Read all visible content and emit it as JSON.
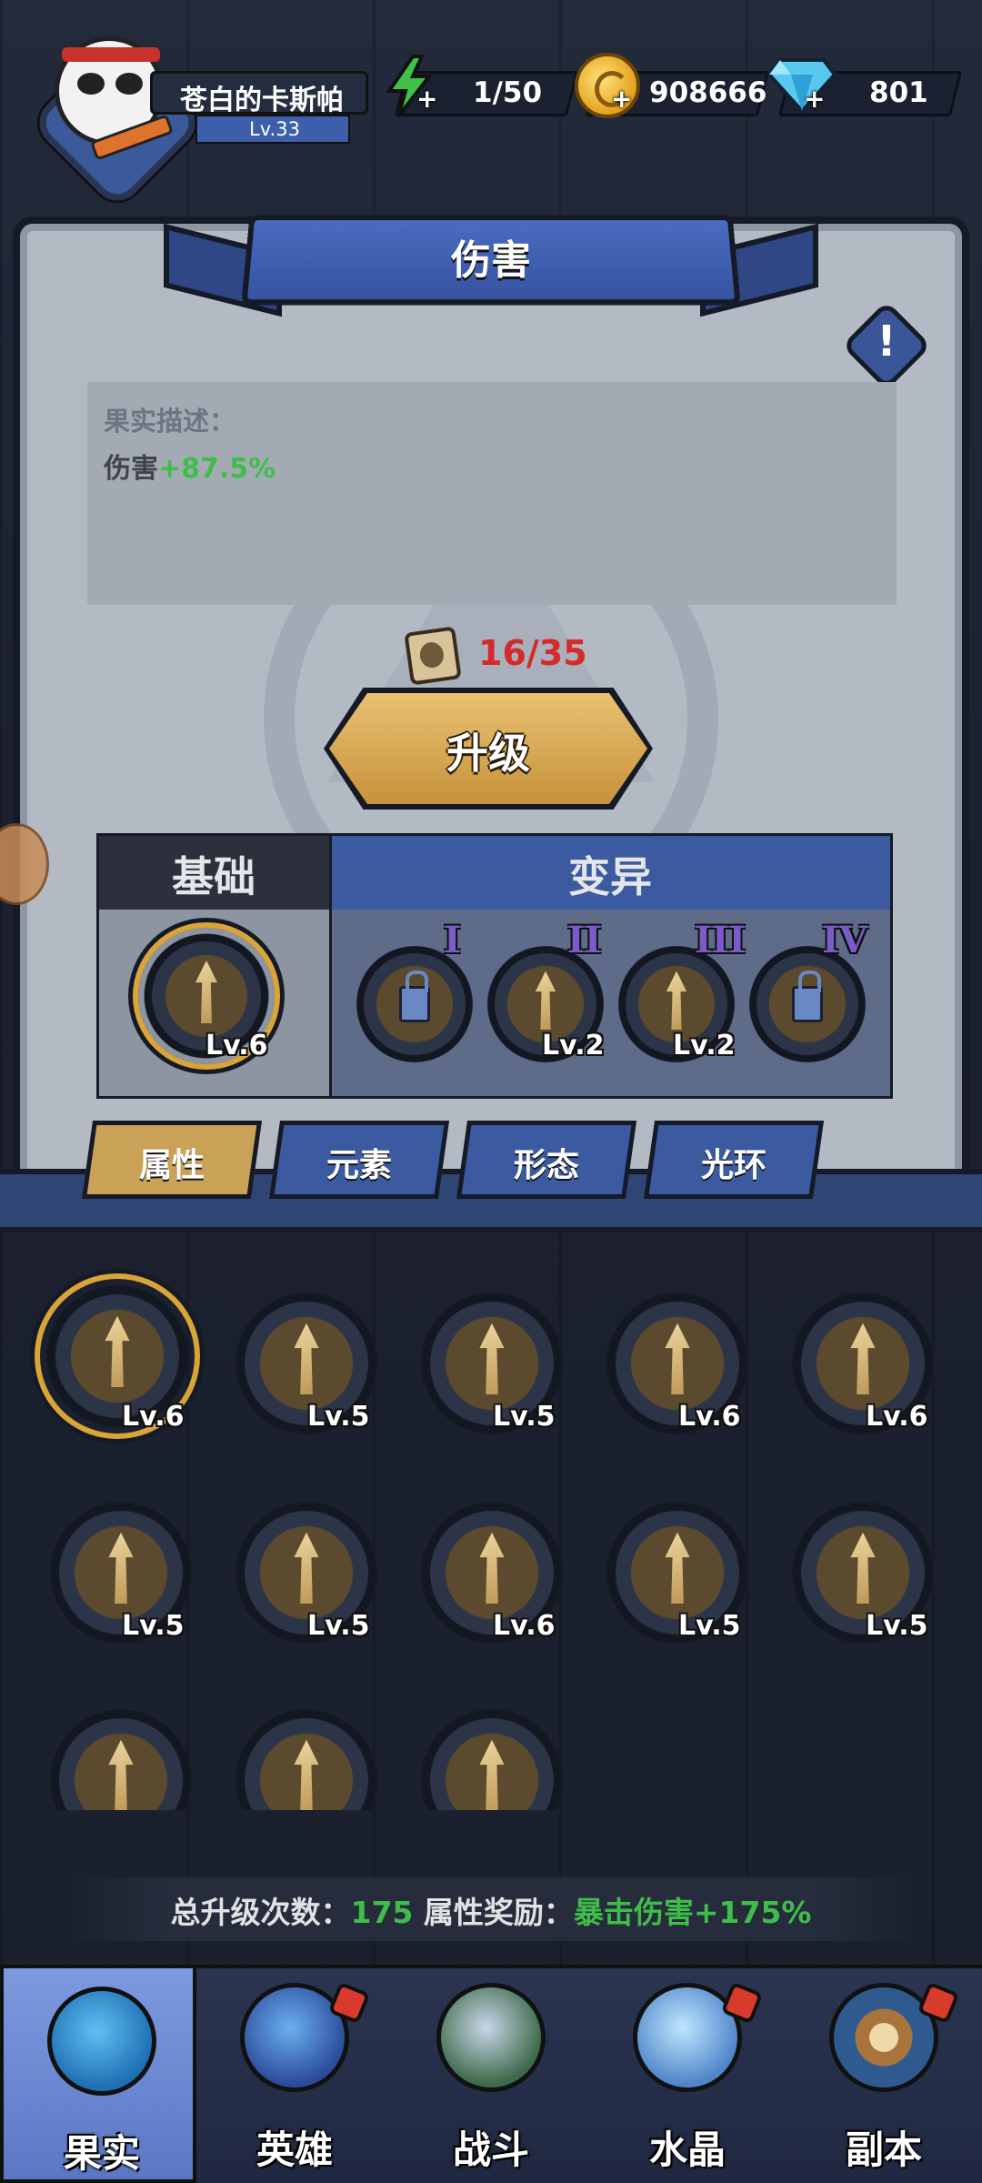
{
  "player": {
    "name": "苍白的卡斯帕",
    "level": "Lv.33"
  },
  "resources": {
    "energy": "1/50",
    "gold": "908666",
    "gems": "801",
    "plus": "+"
  },
  "panel": {
    "title": "伤害",
    "info_mark": "!",
    "description_label": "果实描述：",
    "description_stat": "伤害",
    "description_bonus": "+87.5%",
    "cost": "16/35",
    "upgrade_label": "升级"
  },
  "table": {
    "base_header": "基础",
    "mutation_header": "变异",
    "base_skill": {
      "level": "Lv.6"
    },
    "mutations": [
      {
        "roman": "I",
        "level": "",
        "locked": true
      },
      {
        "roman": "II",
        "level": "Lv.2",
        "locked": false
      },
      {
        "roman": "III",
        "level": "Lv.2",
        "locked": false
      },
      {
        "roman": "IV",
        "level": "",
        "locked": true
      }
    ]
  },
  "category_tabs": [
    {
      "label": "属性",
      "active": true
    },
    {
      "label": "元素",
      "active": false
    },
    {
      "label": "形态",
      "active": false
    },
    {
      "label": "光环",
      "active": false
    }
  ],
  "fruits": [
    {
      "level": "Lv.6"
    },
    {
      "level": "Lv.5"
    },
    {
      "level": "Lv.5"
    },
    {
      "level": "Lv.6"
    },
    {
      "level": "Lv.6"
    },
    {
      "level": "Lv.5"
    },
    {
      "level": "Lv.5"
    },
    {
      "level": "Lv.6"
    },
    {
      "level": "Lv.5"
    },
    {
      "level": "Lv.5"
    },
    {
      "level": ""
    },
    {
      "level": ""
    },
    {
      "level": ""
    }
  ],
  "summary": {
    "total_label": "总升级次数：",
    "total_value": "175",
    "bonus_label": "属性奖励：",
    "bonus_value": "暴击伤害+175%"
  },
  "nav": [
    {
      "label": "果实",
      "active": true,
      "badge": false
    },
    {
      "label": "英雄",
      "active": false,
      "badge": true
    },
    {
      "label": "战斗",
      "active": false,
      "badge": false
    },
    {
      "label": "水晶",
      "active": false,
      "badge": true
    },
    {
      "label": "副本",
      "active": false,
      "badge": true
    }
  ],
  "colors": {
    "accent_blue": "#3c5a9f",
    "gold": "#c9a257",
    "bonus_green": "#3fbd4a",
    "cost_red": "#d42a2a"
  }
}
